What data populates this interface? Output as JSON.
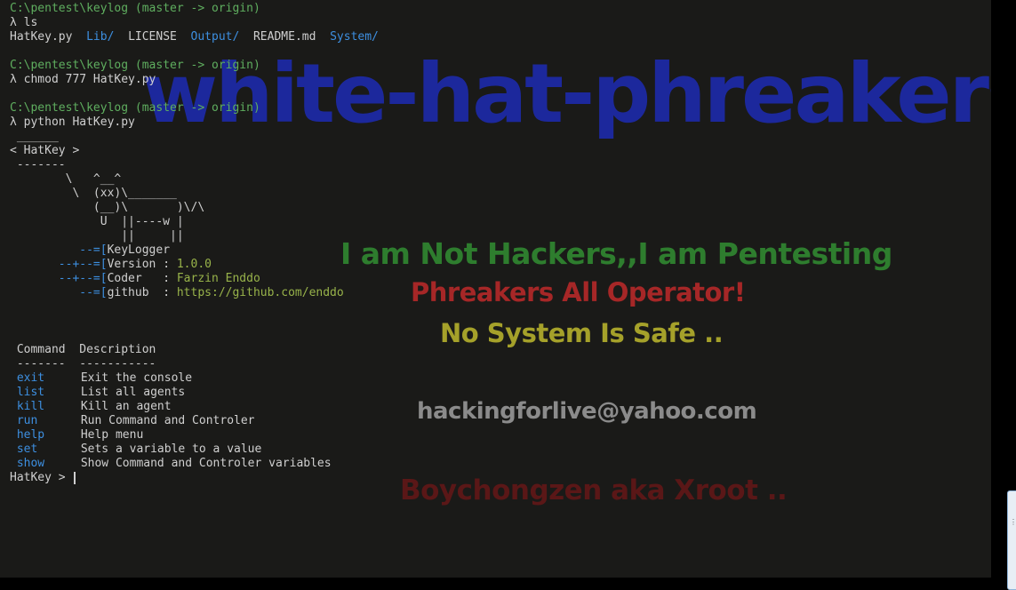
{
  "colors": {
    "background": "#1a1a18",
    "prompt_path": "#5fae5f",
    "directory": "#3d8fe0",
    "value": "#98b34a",
    "text": "#cfcfcf"
  },
  "watermark": {
    "brand": "white-hat-phreakers",
    "line1": "I am Not Hackers,,I am Pentesting",
    "line2": "Phreakers All Operator!",
    "line3": "No System Is Safe ..",
    "email": "hackingforlive@yahoo.com",
    "line5": "Boychongzen aka Xroot .."
  },
  "session": {
    "prompt_path": "C:\\pentest\\keylog",
    "branch": "(master -> origin)",
    "prompt_char": "λ",
    "commands": [
      "ls",
      "chmod 777 HatKey.py",
      "python HatKey.py"
    ],
    "ls_output": {
      "f1": "HatKey.py",
      "d1": "Lib/",
      "f2": "LICENSE",
      "d2": "Output/",
      "f3": "README.md",
      "d3": "System/"
    }
  },
  "banner": {
    "bubble_top": " ______",
    "bubble_text": "< HatKey >",
    "bubble_bottom": " -------",
    "art": [
      "        \\   ^__^",
      "         \\  (xx)\\_______",
      "            (__)\\       )\\/\\",
      "             U  ||----w |",
      "                ||     ||"
    ],
    "info": [
      {
        "prefix": "          --=[",
        "key": "KeyLogger",
        "sep": "",
        "value": ""
      },
      {
        "prefix": "       --+--=[",
        "key": "Version",
        "sep": " : ",
        "value": "1.0.0"
      },
      {
        "prefix": "       --+--=[",
        "key": "Coder  ",
        "sep": " : ",
        "value": "Farzin Enddo"
      },
      {
        "prefix": "          --=[",
        "key": "github ",
        "sep": " : ",
        "value": "https://github.com/enddo"
      }
    ]
  },
  "help_table": {
    "headers": {
      "command": "Command",
      "description": "Description"
    },
    "underline": {
      "command": "-------",
      "description": "-----------"
    },
    "rows": [
      {
        "cmd": "exit",
        "desc": "Exit the console"
      },
      {
        "cmd": "list",
        "desc": "List all agents"
      },
      {
        "cmd": "kill",
        "desc": "Kill an agent"
      },
      {
        "cmd": "run",
        "desc": "Run Command and Controler"
      },
      {
        "cmd": "help",
        "desc": "Help menu"
      },
      {
        "cmd": "set",
        "desc": "Sets a variable to a value"
      },
      {
        "cmd": "show",
        "desc": "Show Command and Controler variables"
      }
    ]
  },
  "final_prompt": "HatKey > "
}
